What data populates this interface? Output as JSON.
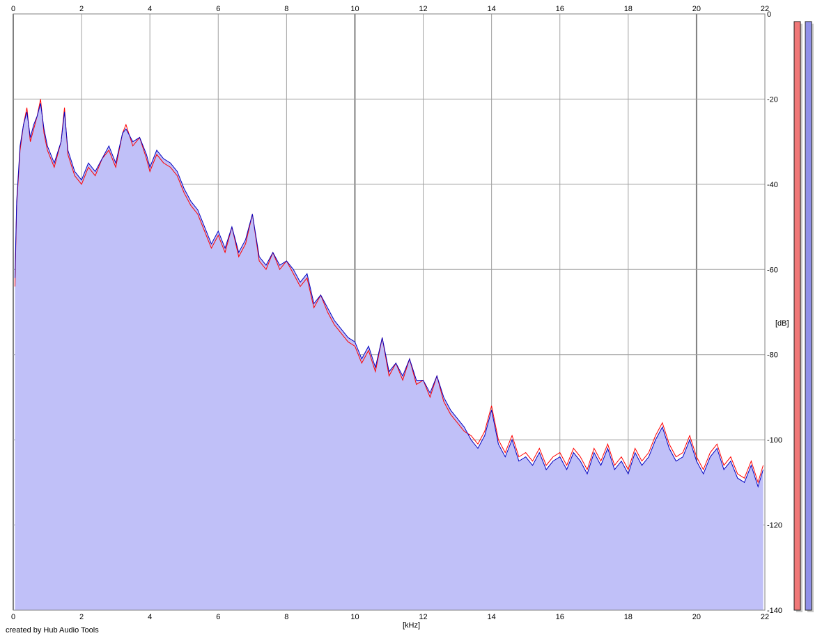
{
  "credit": "created by Hub Audio Tools",
  "colors": {
    "left_line": "#ff0000",
    "right_line": "#0000c0",
    "fill": "#c0c0f8",
    "grid": "#a0a0a0",
    "grid_major": "#808080",
    "meter_left": "#f07878",
    "meter_right": "#9090e8"
  },
  "chart_data": {
    "type": "area",
    "title": "",
    "xlabel": "[kHz]",
    "ylabel": "[dB]",
    "xlim": [
      0,
      22
    ],
    "ylim": [
      -140,
      0
    ],
    "x_ticks": [
      "0",
      "2",
      "4",
      "6",
      "8",
      "10",
      "12",
      "14",
      "16",
      "18",
      "20",
      "22"
    ],
    "y_ticks": [
      "0",
      "-20",
      "-40",
      "-60",
      "-80",
      "-100",
      "-120",
      "-140"
    ],
    "grid": true,
    "x": [
      0.05,
      0.1,
      0.2,
      0.3,
      0.4,
      0.5,
      0.6,
      0.7,
      0.8,
      0.9,
      1.0,
      1.2,
      1.4,
      1.5,
      1.6,
      1.8,
      2.0,
      2.2,
      2.4,
      2.6,
      2.8,
      3.0,
      3.2,
      3.3,
      3.5,
      3.7,
      3.9,
      4.0,
      4.2,
      4.4,
      4.6,
      4.8,
      5.0,
      5.2,
      5.4,
      5.6,
      5.8,
      6.0,
      6.2,
      6.4,
      6.6,
      6.8,
      7.0,
      7.2,
      7.4,
      7.6,
      7.8,
      8.0,
      8.2,
      8.4,
      8.6,
      8.8,
      9.0,
      9.2,
      9.4,
      9.6,
      9.8,
      10.0,
      10.2,
      10.4,
      10.6,
      10.8,
      11.0,
      11.2,
      11.4,
      11.6,
      11.8,
      12.0,
      12.2,
      12.4,
      12.6,
      12.8,
      13.0,
      13.2,
      13.4,
      13.6,
      13.8,
      14.0,
      14.2,
      14.4,
      14.6,
      14.8,
      15.0,
      15.2,
      15.4,
      15.6,
      15.8,
      16.0,
      16.2,
      16.4,
      16.6,
      16.8,
      17.0,
      17.2,
      17.4,
      17.6,
      17.8,
      18.0,
      18.2,
      18.4,
      18.6,
      18.8,
      19.0,
      19.2,
      19.4,
      19.6,
      19.8,
      20.0,
      20.2,
      20.4,
      20.6,
      20.8,
      21.0,
      21.2,
      21.4,
      21.6,
      21.8,
      21.95
    ],
    "series": [
      {
        "values": [
          -64,
          -45,
          -32,
          -26,
          -22,
          -30,
          -27,
          -24,
          -20,
          -28,
          -32,
          -36,
          -30,
          -22,
          -33,
          -38,
          -40,
          -36,
          -38,
          -34,
          -32,
          -36,
          -28,
          -26,
          -31,
          -29,
          -34,
          -37,
          -33,
          -35,
          -36,
          -38,
          -42,
          -45,
          -47,
          -51,
          -55,
          -52,
          -56,
          -50,
          -57,
          -54,
          -47,
          -58,
          -60,
          -56,
          -60,
          -58,
          -61,
          -64,
          -62,
          -69,
          -66,
          -70,
          -73,
          -75,
          -77,
          -78,
          -82,
          -79,
          -84,
          -76,
          -85,
          -82,
          -86,
          -81,
          -87,
          -86,
          -90,
          -85,
          -91,
          -94,
          -96,
          -98,
          -99,
          -101,
          -98,
          -92,
          -100,
          -103,
          -99,
          -104,
          -103,
          -105,
          -102,
          -106,
          -104,
          -103,
          -106,
          -102,
          -104,
          -107,
          -102,
          -105,
          -101,
          -106,
          -104,
          -107,
          -102,
          -105,
          -103,
          -99,
          -96,
          -101,
          -104,
          -103,
          -99,
          -104,
          -107,
          -103,
          -101,
          -106,
          -104,
          -108,
          -109,
          -105,
          -110,
          -106
        ]
      },
      {
        "values": [
          -62,
          -44,
          -31,
          -26,
          -23,
          -29,
          -26,
          -24,
          -21,
          -27,
          -31,
          -35,
          -30,
          -23,
          -32,
          -37,
          -39,
          -35,
          -37,
          -34,
          -31,
          -35,
          -28,
          -27,
          -30,
          -29,
          -33,
          -36,
          -32,
          -34,
          -35,
          -37,
          -41,
          -44,
          -46,
          -50,
          -54,
          -51,
          -55,
          -50,
          -56,
          -53,
          -47,
          -57,
          -59,
          -56,
          -59,
          -58,
          -60,
          -63,
          -61,
          -68,
          -66,
          -69,
          -72,
          -74,
          -76,
          -77,
          -81,
          -78,
          -83,
          -76,
          -84,
          -82,
          -85,
          -81,
          -86,
          -86,
          -89,
          -85,
          -90,
          -93,
          -95,
          -97,
          -100,
          -102,
          -99,
          -93,
          -101,
          -104,
          -100,
          -105,
          -104,
          -106,
          -103,
          -107,
          -105,
          -104,
          -107,
          -103,
          -105,
          -108,
          -103,
          -106,
          -102,
          -107,
          -105,
          -108,
          -103,
          -106,
          -104,
          -100,
          -97,
          -102,
          -105,
          -104,
          -100,
          -105,
          -108,
          -104,
          -102,
          -107,
          -105,
          -109,
          -110,
          -106,
          -111,
          -107
        ]
      }
    ],
    "meters": [
      {
        "level": 1.0
      },
      {
        "level": 1.0
      }
    ]
  }
}
